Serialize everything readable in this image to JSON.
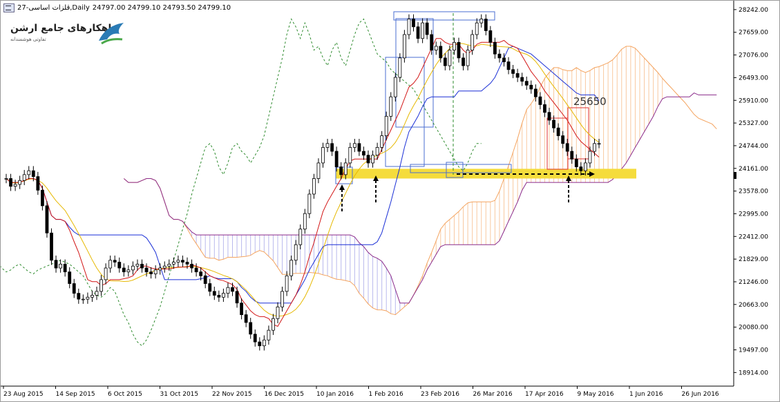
{
  "window": {
    "symbol_period": "27-ﻗﻠﺰات اﺳﺎﺳﯽ,Daily",
    "ohlc": "24797.00 24799.10 24793.50 24799.10"
  },
  "logo": {
    "title": "راهکارهای جامع ارشن",
    "subtitle": "تفاوتی هوشمندانه",
    "icon": "bird-logo-icon"
  },
  "chart_data": {
    "type": "candlestick",
    "y_ticks": [
      "28242.00",
      "27659.00",
      "27076.00",
      "26493.00",
      "25910.00",
      "25327.00",
      "24744.00",
      "24161.00",
      "23578.00",
      "22995.00",
      "22412.00",
      "21829.00",
      "21246.00",
      "20663.00",
      "20080.00",
      "19497.00",
      "18914.00"
    ],
    "ylim": [
      18600,
      28400
    ],
    "x_ticks": [
      "23 Aug 2015",
      "14 Sep 2015",
      "6 Oct 2015",
      "31 Oct 2015",
      "22 Nov 2015",
      "16 Dec 2015",
      "10 Jan 2016",
      "1 Feb 2016",
      "23 Feb 2016",
      "26 Mar 2016",
      "17 Apr 2016",
      "9 May 2016",
      "1 Jun 2016",
      "26 Jun 2016"
    ],
    "annotation": "25650",
    "support_zone": [
      23900,
      24150
    ],
    "closes": [
      23900,
      23700,
      23750,
      23850,
      24000,
      24100,
      23950,
      23600,
      23200,
      22500,
      21800,
      21600,
      21700,
      21500,
      21200,
      20950,
      20800,
      20800,
      20850,
      20900,
      21000,
      21300,
      21600,
      21800,
      21750,
      21600,
      21500,
      21550,
      21650,
      21700,
      21600,
      21500,
      21450,
      21550,
      21600,
      21650,
      21700,
      21750,
      21800,
      21750,
      21700,
      21600,
      21500,
      21400,
      21200,
      21000,
      20900,
      20850,
      20950,
      21100,
      21000,
      20700,
      20400,
      20200,
      19900,
      19700,
      19600,
      19750,
      20000,
      20300,
      20600,
      21000,
      21400,
      21800,
      22200,
      22600,
      23000,
      23500,
      23900,
      24300,
      24700,
      24800,
      24600,
      24200,
      24000,
      24300,
      24700,
      24800,
      24600,
      24500,
      24300,
      24500,
      24700,
      25000,
      25500,
      26000,
      26500,
      27000,
      27600,
      28000,
      27800,
      27500,
      27900,
      27600,
      27200,
      27300,
      27000,
      26800,
      27200,
      27400,
      27000,
      26800,
      27200,
      27600,
      27900,
      28000,
      27700,
      27400,
      27100,
      27000,
      26900,
      26700,
      26600,
      26500,
      26400,
      26300,
      26200,
      26000,
      25800,
      25600,
      25400,
      25200,
      25000,
      24800,
      24600,
      24400,
      24200,
      24100,
      24300,
      24600,
      24800,
      24800
    ]
  },
  "colors": {
    "up": "#ffffff",
    "down": "#000000",
    "tenkan": "#d21414",
    "kijun": "#1a2fd6",
    "chikou": "#2e8b2e",
    "ma": "#e6b800",
    "cloud_bull": "#f4a460",
    "cloud_bear": "#8a8ae0",
    "zone": "#f5dc3c"
  }
}
